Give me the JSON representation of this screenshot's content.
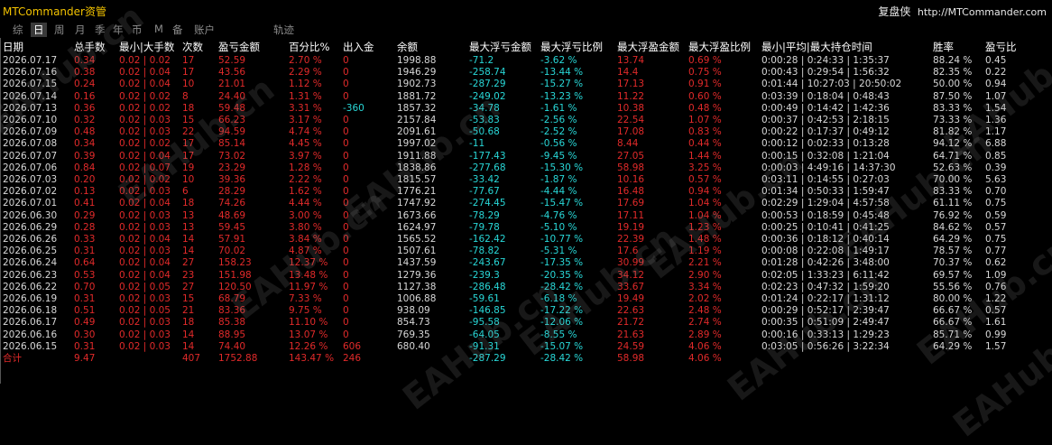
{
  "app_title": "MTCommander资管",
  "brand": {
    "name": "复盘侠",
    "url": "http://MTCommander.com"
  },
  "tabs": [
    {
      "label": "综",
      "active": false
    },
    {
      "label": "日",
      "active": true
    },
    {
      "label": "周",
      "active": false
    },
    {
      "label": "月",
      "active": false
    },
    {
      "label": "季",
      "active": false
    },
    {
      "label": "年",
      "active": false
    },
    {
      "label": "币",
      "active": false
    },
    {
      "label": "M",
      "active": false
    },
    {
      "label": "备",
      "active": false
    },
    {
      "label": "账户",
      "active": false
    },
    {
      "label": "轨迹",
      "active": false
    }
  ],
  "watermark": "EAHub.cn",
  "columns": [
    "日期",
    "总手数",
    "最小|大手数",
    "次数",
    "盈亏金额",
    "百分比%",
    "出入金",
    "余额",
    "最大浮亏金额",
    "最大浮亏比例",
    "最大浮盈金额",
    "最大浮盈比例",
    "最小|平均|最大持仓时间",
    "胜率",
    "盈亏比"
  ],
  "rows": [
    [
      "2026.07.17",
      "0.34",
      "0.02 | 0.02",
      "17",
      "52.59",
      "2.70 %",
      "0",
      "1998.88",
      "-71.2",
      "-3.62 %",
      "13.74",
      "0.69 %",
      "0:00:28 | 0:24:33 | 1:35:37",
      "88.24 %",
      "0.45"
    ],
    [
      "2026.07.16",
      "0.38",
      "0.02 | 0.04",
      "17",
      "43.56",
      "2.29 %",
      "0",
      "1946.29",
      "-258.74",
      "-13.44 %",
      "14.4",
      "0.75 %",
      "0:00:43 | 0:29:54 | 1:56:32",
      "82.35 %",
      "0.22"
    ],
    [
      "2026.07.15",
      "0.24",
      "0.02 | 0.04",
      "10",
      "21.01",
      "1.12 %",
      "0",
      "1902.73",
      "-287.29",
      "-15.27 %",
      "17.13",
      "0.91 %",
      "0:01:44 | 10:27:03 | 20:50:02",
      "50.00 %",
      "0.94"
    ],
    [
      "2026.07.14",
      "0.16",
      "0.02 | 0.02",
      "8",
      "24.40",
      "1.31 %",
      "0",
      "1881.72",
      "-249.02",
      "-13.23 %",
      "11.22",
      "0.60 %",
      "0:03:39 | 0:18:04 | 0:48:43",
      "87.50 %",
      "1.07"
    ],
    [
      "2026.07.13",
      "0.36",
      "0.02 | 0.02",
      "18",
      "59.48",
      "3.31 %",
      "-360",
      "1857.32",
      "-34.78",
      "-1.61 %",
      "10.38",
      "0.48 %",
      "0:00:49 | 0:14:42 | 1:42:36",
      "83.33 %",
      "1.54"
    ],
    [
      "2026.07.10",
      "0.32",
      "0.02 | 0.03",
      "15",
      "66.23",
      "3.17 %",
      "0",
      "2157.84",
      "-53.83",
      "-2.56 %",
      "22.54",
      "1.07 %",
      "0:00:37 | 0:42:53 | 2:18:15",
      "73.33 %",
      "1.36"
    ],
    [
      "2026.07.09",
      "0.48",
      "0.02 | 0.03",
      "22",
      "94.59",
      "4.74 %",
      "0",
      "2091.61",
      "-50.68",
      "-2.52 %",
      "17.08",
      "0.83 %",
      "0:00:22 | 0:17:37 | 0:49:12",
      "81.82 %",
      "1.17"
    ],
    [
      "2026.07.08",
      "0.34",
      "0.02 | 0.02",
      "17",
      "85.14",
      "4.45 %",
      "0",
      "1997.02",
      "-11",
      "-0.56 %",
      "8.44",
      "0.44 %",
      "0:00:12 | 0:02:33 | 0:13:28",
      "94.12 %",
      "6.88"
    ],
    [
      "2026.07.07",
      "0.39",
      "0.02 | 0.04",
      "17",
      "73.02",
      "3.97 %",
      "0",
      "1911.88",
      "-177.43",
      "-9.45 %",
      "27.05",
      "1.44 %",
      "0:00:15 | 0:32:08 | 1:21:04",
      "64.71 %",
      "0.85"
    ],
    [
      "2026.07.06",
      "0.84",
      "0.02 | 0.07",
      "19",
      "23.29",
      "1.28 %",
      "0",
      "1838.86",
      "-277.68",
      "-15.30 %",
      "58.98",
      "3.25 %",
      "0:00:03 | 4:49:16 | 14:37:30",
      "52.63 %",
      "0.39"
    ],
    [
      "2026.07.03",
      "0.20",
      "0.02 | 0.02",
      "10",
      "39.36",
      "2.22 %",
      "0",
      "1815.57",
      "-33.42",
      "-1.87 %",
      "10.16",
      "0.57 %",
      "0:03:11 | 0:14:55 | 0:27:03",
      "70.00 %",
      "5.63"
    ],
    [
      "2026.07.02",
      "0.13",
      "0.02 | 0.03",
      "6",
      "28.29",
      "1.62 %",
      "0",
      "1776.21",
      "-77.67",
      "-4.44 %",
      "16.48",
      "0.94 %",
      "0:01:34 | 0:50:33 | 1:59:47",
      "83.33 %",
      "0.70"
    ],
    [
      "2026.07.01",
      "0.41",
      "0.02 | 0.04",
      "18",
      "74.26",
      "4.44 %",
      "0",
      "1747.92",
      "-274.45",
      "-15.47 %",
      "17.69",
      "1.04 %",
      "0:02:29 | 1:29:04 | 4:57:58",
      "61.11 %",
      "0.75"
    ],
    [
      "2026.06.30",
      "0.29",
      "0.02 | 0.03",
      "13",
      "48.69",
      "3.00 %",
      "0",
      "1673.66",
      "-78.29",
      "-4.76 %",
      "17.11",
      "1.04 %",
      "0:00:53 | 0:18:59 | 0:45:48",
      "76.92 %",
      "0.59"
    ],
    [
      "2026.06.29",
      "0.28",
      "0.02 | 0.03",
      "13",
      "59.45",
      "3.80 %",
      "0",
      "1624.97",
      "-79.78",
      "-5.10 %",
      "19.19",
      "1.23 %",
      "0:00:25 | 0:10:41 | 0:41:25",
      "84.62 %",
      "0.57"
    ],
    [
      "2026.06.26",
      "0.33",
      "0.02 | 0.04",
      "14",
      "57.91",
      "3.84 %",
      "0",
      "1565.52",
      "-162.42",
      "-10.77 %",
      "22.39",
      "1.48 %",
      "0:00:36 | 0:18:12 | 0:40:14",
      "64.29 %",
      "0.75"
    ],
    [
      "2026.06.25",
      "0.31",
      "0.02 | 0.03",
      "14",
      "70.02",
      "4.87 %",
      "0",
      "1507.61",
      "-78.82",
      "-5.31 %",
      "17.6",
      "1.19 %",
      "0:00:08 | 0:22:08 | 1:49:17",
      "78.57 %",
      "0.77"
    ],
    [
      "2026.06.24",
      "0.64",
      "0.02 | 0.04",
      "27",
      "158.23",
      "12.37 %",
      "0",
      "1437.59",
      "-243.67",
      "-17.35 %",
      "30.99",
      "2.21 %",
      "0:01:28 | 0:42:26 | 3:48:00",
      "70.37 %",
      "0.62"
    ],
    [
      "2026.06.23",
      "0.53",
      "0.02 | 0.04",
      "23",
      "151.98",
      "13.48 %",
      "0",
      "1279.36",
      "-239.3",
      "-20.35 %",
      "34.12",
      "2.90 %",
      "0:02:05 | 1:33:23 | 6:11:42",
      "69.57 %",
      "1.09"
    ],
    [
      "2026.06.22",
      "0.70",
      "0.02 | 0.05",
      "27",
      "120.50",
      "11.97 %",
      "0",
      "1127.38",
      "-286.48",
      "-28.42 %",
      "33.67",
      "3.34 %",
      "0:02:23 | 0:47:32 | 1:59:20",
      "55.56 %",
      "0.76"
    ],
    [
      "2026.06.19",
      "0.31",
      "0.02 | 0.03",
      "15",
      "68.79",
      "7.33 %",
      "0",
      "1006.88",
      "-59.61",
      "-6.18 %",
      "19.49",
      "2.02 %",
      "0:01:24 | 0:22:17 | 1:31:12",
      "80.00 %",
      "1.22"
    ],
    [
      "2026.06.18",
      "0.51",
      "0.02 | 0.05",
      "21",
      "83.36",
      "9.75 %",
      "0",
      "938.09",
      "-146.85",
      "-17.22 %",
      "22.63",
      "2.48 %",
      "0:00:29 | 0:52:17 | 2:39:47",
      "66.67 %",
      "0.57"
    ],
    [
      "2026.06.17",
      "0.49",
      "0.02 | 0.03",
      "18",
      "85.38",
      "11.10 %",
      "0",
      "854.73",
      "-95.58",
      "-12.06 %",
      "21.72",
      "2.74 %",
      "0:00:35 | 0:51:09 | 2:49:47",
      "66.67 %",
      "1.61"
    ],
    [
      "2026.06.16",
      "0.30",
      "0.02 | 0.03",
      "14",
      "88.95",
      "13.07 %",
      "0",
      "769.35",
      "-64.05",
      "-8.55 %",
      "21.63",
      "2.89 %",
      "0:00:16 | 0:33:13 | 1:29:23",
      "85.71 %",
      "0.99"
    ],
    [
      "2026.06.15",
      "0.31",
      "0.02 | 0.03",
      "14",
      "74.40",
      "12.26 %",
      "606",
      "680.40",
      "-91.31",
      "-15.07 %",
      "24.59",
      "4.06 %",
      "0:03:05 | 0:56:26 | 3:22:34",
      "64.29 %",
      "1.57"
    ]
  ],
  "totals": [
    "合计",
    "9.47",
    "",
    "407",
    "1752.88",
    "143.47 %",
    "246",
    "",
    "-287.29",
    "-28.42 %",
    "58.98",
    "4.06 %",
    "",
    "",
    ""
  ]
}
